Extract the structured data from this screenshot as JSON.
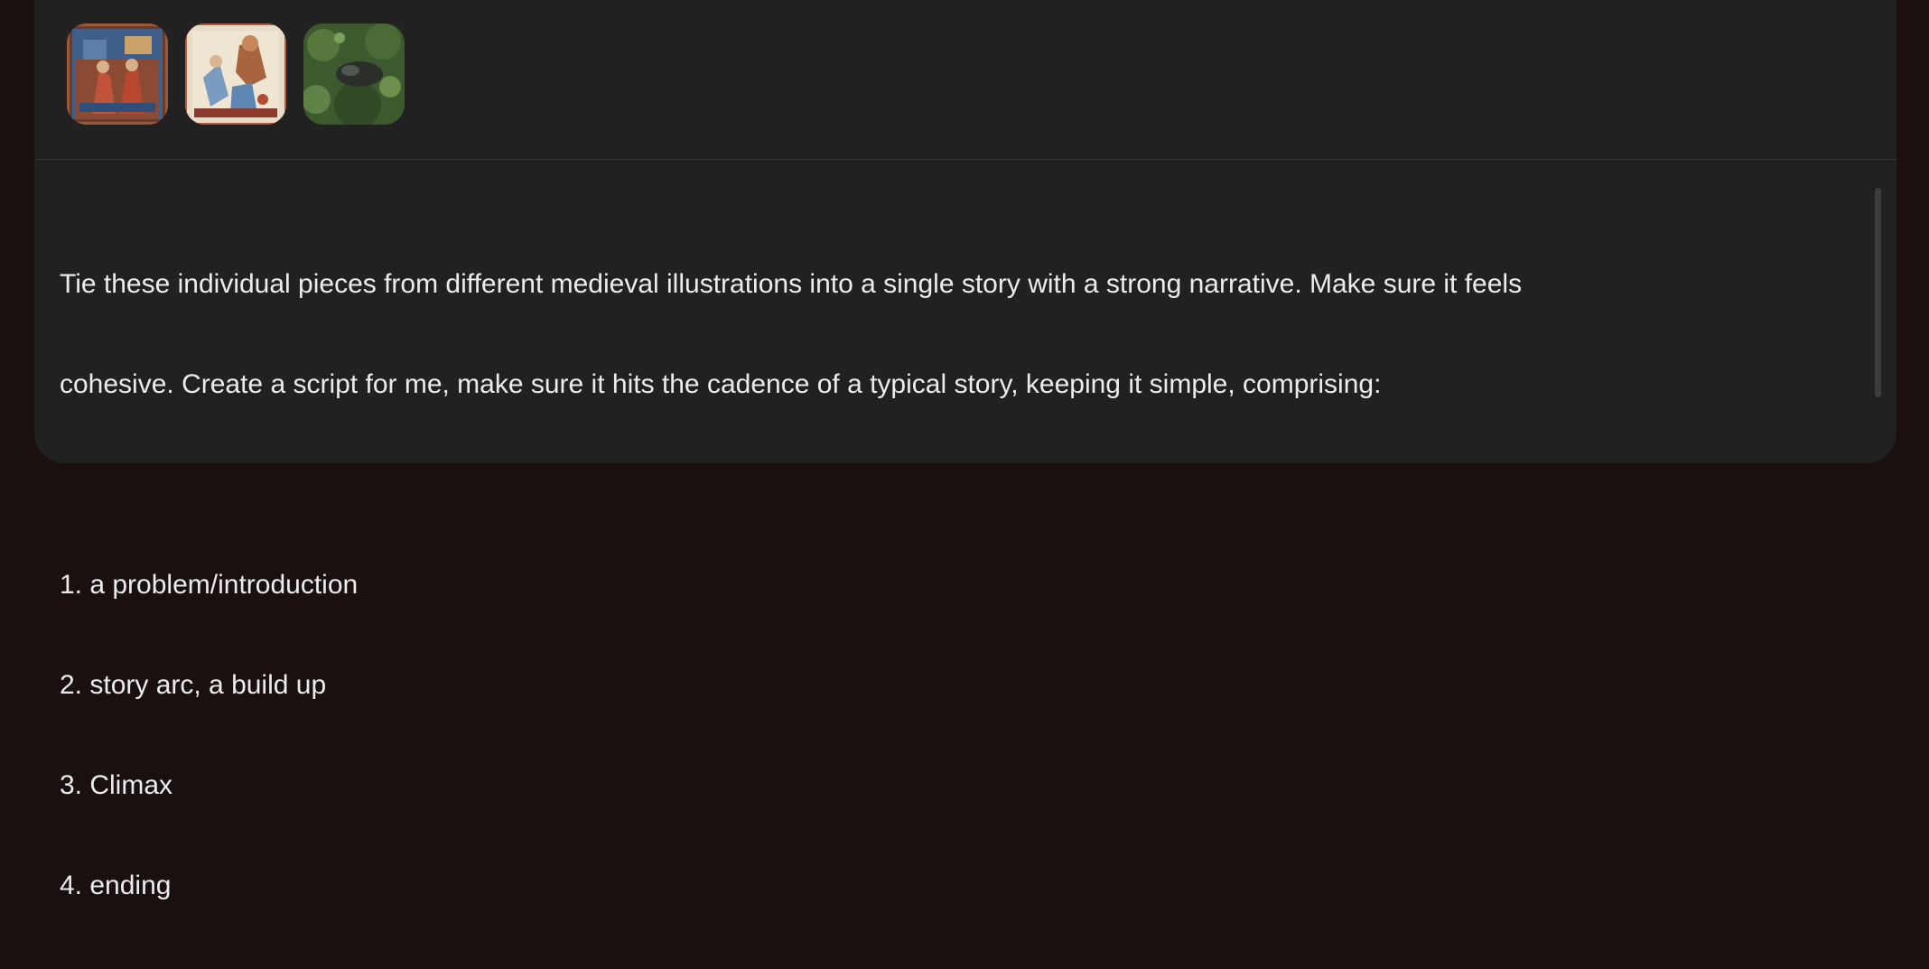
{
  "attachments": [
    {
      "icon": "medieval-illustration-thumbnail-1"
    },
    {
      "icon": "medieval-illustration-thumbnail-2"
    },
    {
      "icon": "medieval-illustration-thumbnail-3"
    }
  ],
  "prompt": {
    "line1": "Tie these individual pieces from different medieval illustrations into a single story with a strong narrative. Make sure it feels",
    "line2": "cohesive. Create a script for me, make sure it hits the cadence of a typical story, keeping it simple, comprising:",
    "items": [
      "1. a problem/introduction",
      "2. story arc, a build up",
      "3. Climax",
      "4. ending"
    ]
  },
  "colors": {
    "background": "#1a1010",
    "panel": "#212121",
    "text": "#ececec"
  }
}
